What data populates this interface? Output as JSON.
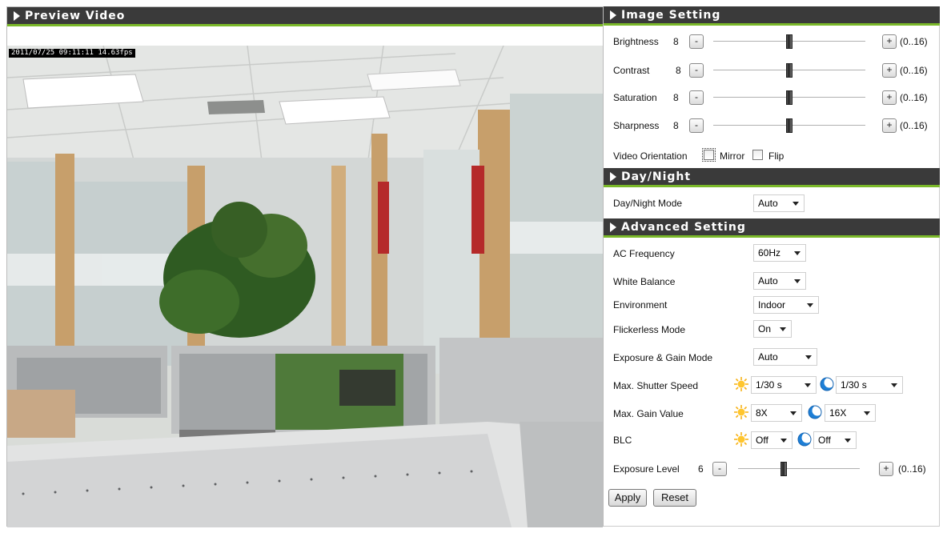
{
  "preview": {
    "title": "Preview Video",
    "osd_text": "2011/07/25 09:11:11 14.63fps"
  },
  "image_setting": {
    "title": "Image Setting",
    "sliders": [
      {
        "label": "Brightness",
        "value": "8",
        "minus": "-",
        "plus": "+",
        "range": "(0..16)",
        "level": 0.5
      },
      {
        "label": "Contrast",
        "value": "8",
        "minus": "-",
        "plus": "+",
        "range": "(0..16)",
        "level": 0.5
      },
      {
        "label": "Saturation",
        "value": "8",
        "minus": "-",
        "plus": "+",
        "range": "(0..16)",
        "level": 0.5
      },
      {
        "label": "Sharpness",
        "value": "8",
        "minus": "-",
        "plus": "+",
        "range": "(0..16)",
        "level": 0.5
      }
    ],
    "orientation_label": "Video Orientation",
    "mirror_label": "Mirror",
    "flip_label": "Flip"
  },
  "day_night": {
    "title": "Day/Night",
    "mode_label": "Day/Night Mode",
    "mode_value": "Auto"
  },
  "advanced": {
    "title": "Advanced Setting",
    "ac_label": "AC Frequency",
    "ac_value": "60Hz",
    "wb_label": "White Balance",
    "wb_value": "Auto",
    "env_label": "Environment",
    "env_value": "Indoor",
    "flicker_label": "Flickerless Mode",
    "flicker_value": "On",
    "exposure_mode_label": "Exposure & Gain Mode",
    "exposure_mode_value": "Auto",
    "shutter_label": "Max. Shutter Speed",
    "shutter_day": "1/30 s",
    "shutter_night": "1/30 s",
    "gain_label": "Max. Gain Value",
    "gain_day": "8X",
    "gain_night": "16X",
    "blc_label": "BLC",
    "blc_day": "Off",
    "blc_night": "Off",
    "exposure_level_label": "Exposure Level",
    "exposure_level_value": "6",
    "exposure_level_minus": "-",
    "exposure_level_plus": "+",
    "exposure_level_range": "(0..16)",
    "exposure_level_fraction": 0.375,
    "apply_label": "Apply",
    "reset_label": "Reset"
  },
  "icons": {
    "day": "sun-icon",
    "night": "moon-icon",
    "section_marker": "triangle-right-icon"
  },
  "colors": {
    "header_bg": "#3a3a3a",
    "header_accent": "#7ab829"
  }
}
